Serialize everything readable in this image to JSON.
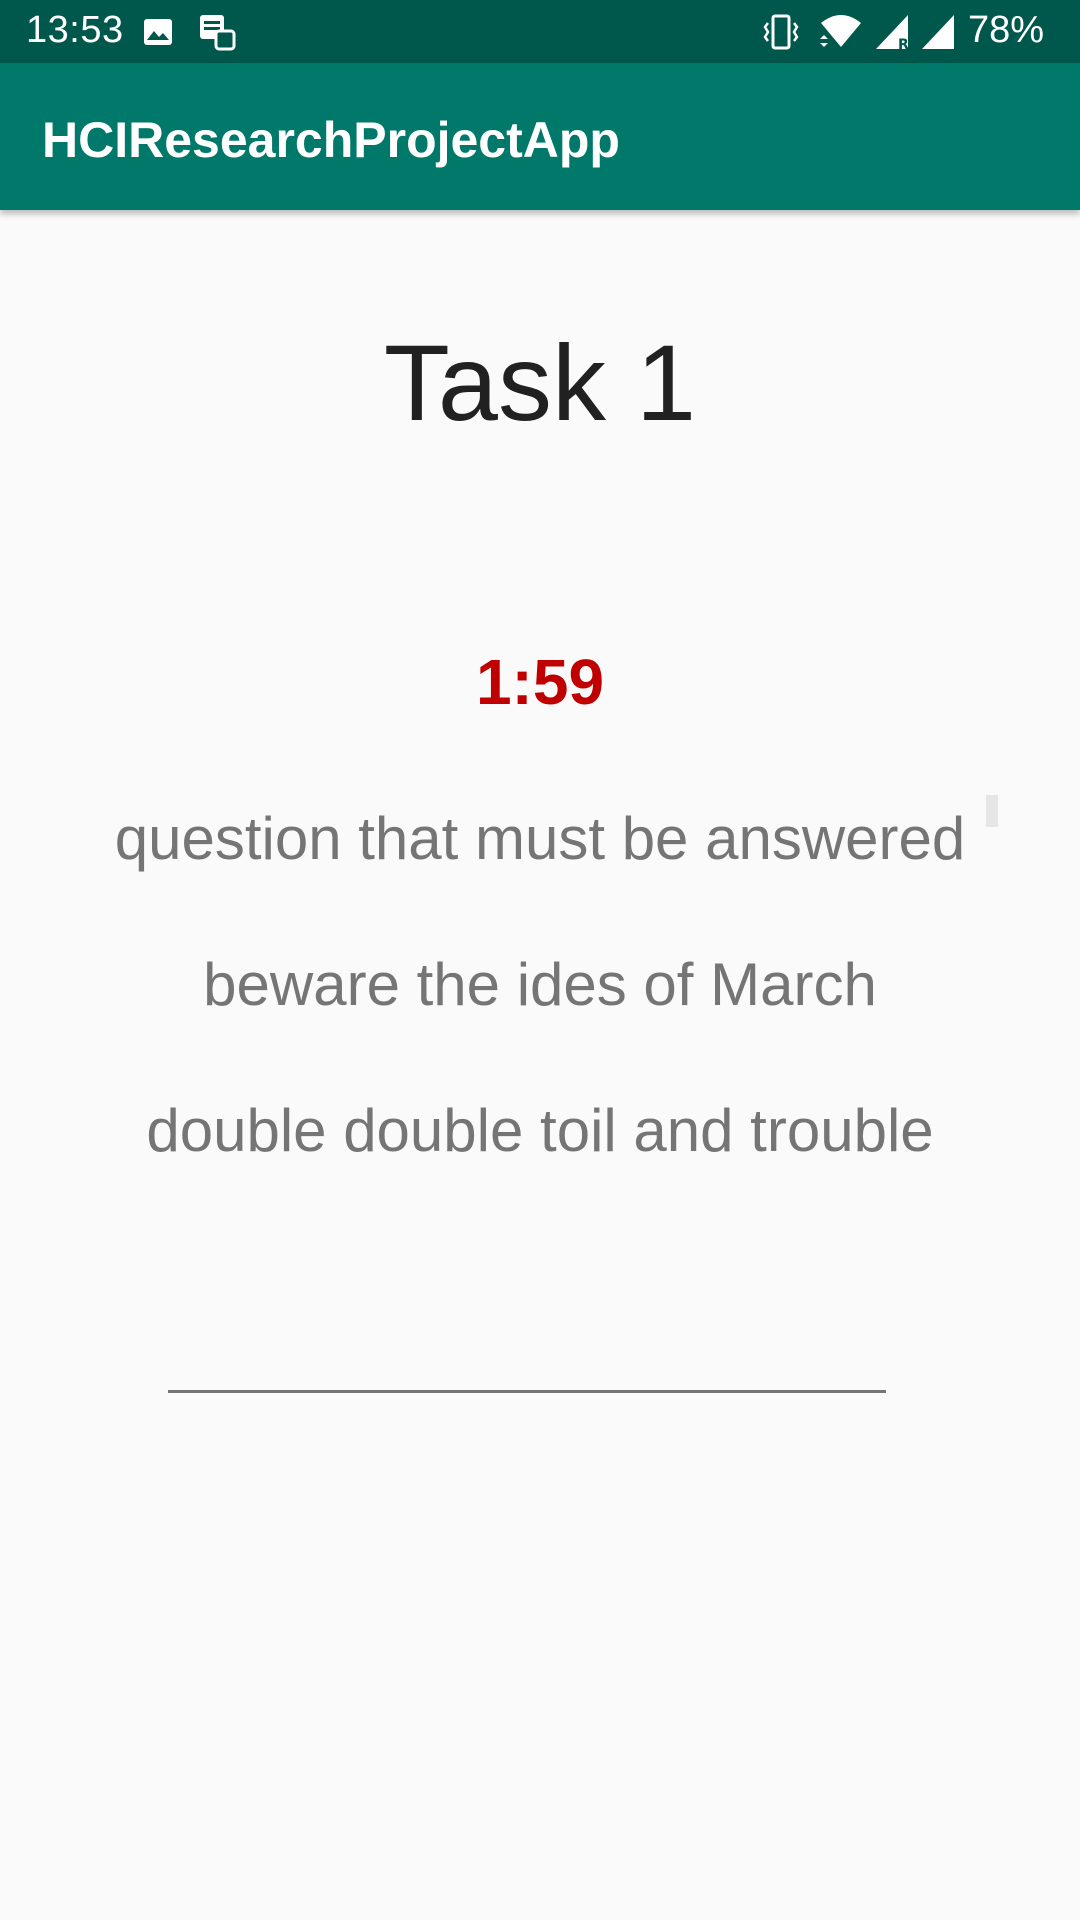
{
  "status_bar": {
    "time": "13:53",
    "battery": "78%",
    "icons": [
      "image-icon",
      "notification-icon",
      "vibrate-icon",
      "wifi-icon",
      "signal-r-icon",
      "signal-icon"
    ]
  },
  "app_bar": {
    "title": "HCIResearchProjectApp"
  },
  "task": {
    "title": "Task 1",
    "timer": "1:59",
    "phrases": [
      "question that must be answered",
      "beware the ides of March",
      "double double toil and trouble"
    ]
  },
  "answer_input": {
    "value": "",
    "placeholder": ""
  },
  "colors": {
    "status_bar": "#00574b",
    "app_bar": "#00796b",
    "timer": "#c00000",
    "phrase_text": "#757575"
  }
}
